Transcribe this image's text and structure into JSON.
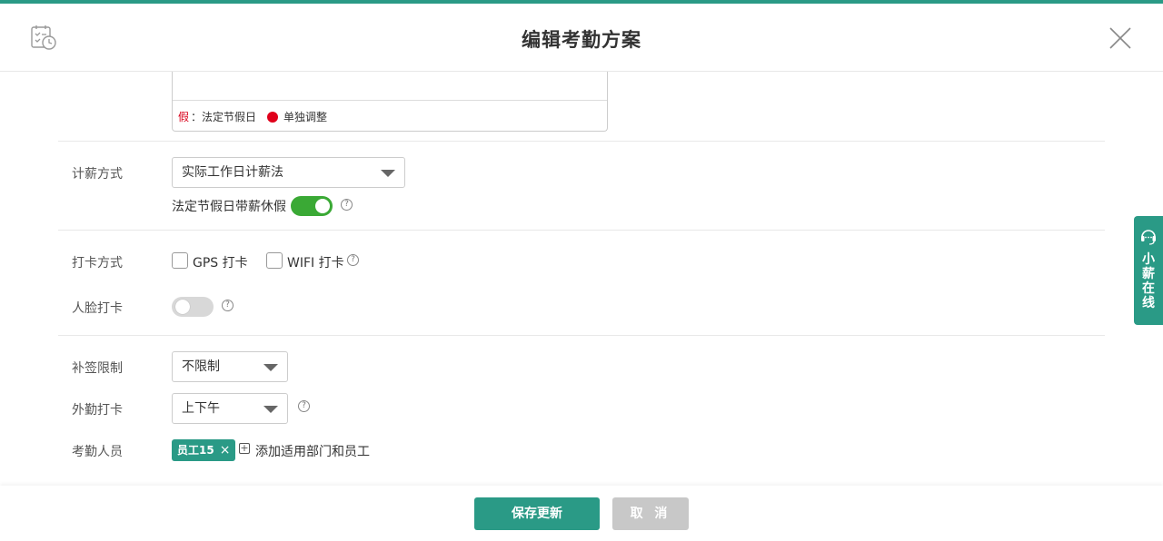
{
  "header": {
    "title": "编辑考勤方案"
  },
  "calendar": {
    "legend_holiday_mark": "假",
    "legend_holiday_sep": "：",
    "legend_holiday_label": "法定节假日",
    "legend_adjust_label": "单独调整",
    "adjust_dot_color": "#e0001b"
  },
  "salary": {
    "label": "计薪方式",
    "method_value": "实际工作日计薪法",
    "paid_holiday_label": "法定节假日带薪休假",
    "paid_holiday_enabled": true
  },
  "punch": {
    "label": "打卡方式",
    "gps_label": "GPS 打卡",
    "gps_checked": false,
    "wifi_label": "WIFI 打卡",
    "wifi_checked": false
  },
  "face": {
    "label": "人脸打卡",
    "enabled": false
  },
  "supplement": {
    "label": "补签限制",
    "value": "不限制"
  },
  "field_punch": {
    "label": "外勤打卡",
    "value": "上下午"
  },
  "members": {
    "label": "考勤人员",
    "tag": "员工15",
    "add_label": "添加适用部门和员工"
  },
  "footer": {
    "save_label": "保存更新",
    "cancel_label": "取 消"
  },
  "side_widget": {
    "label": "小薪在线"
  },
  "colors": {
    "accent": "#2a9a86",
    "toggle_on": "#3aa935"
  },
  "icons": [
    "calendar-clock-icon",
    "close-icon",
    "help-icon",
    "headset-icon",
    "plus-square-icon"
  ]
}
